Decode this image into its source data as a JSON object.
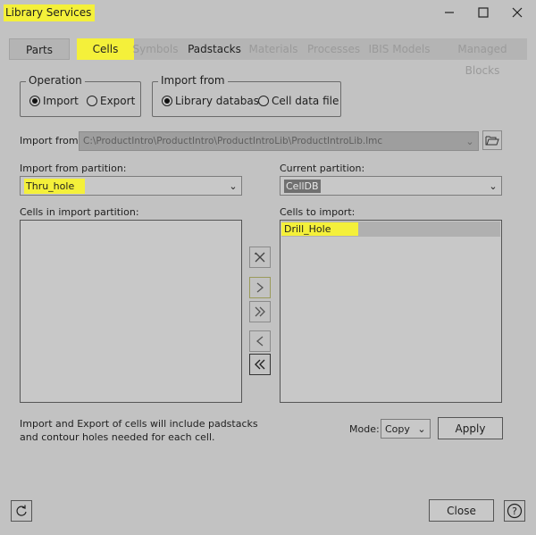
{
  "window": {
    "title": "Library Services"
  },
  "tabs": [
    {
      "label": "Parts",
      "state": "normal"
    },
    {
      "label": "Cells",
      "state": "active"
    },
    {
      "label": "Symbols",
      "state": "disabled"
    },
    {
      "label": "Padstacks",
      "state": "normal"
    },
    {
      "label": "Materials",
      "state": "disabled"
    },
    {
      "label": "Processes",
      "state": "disabled"
    },
    {
      "label": "IBIS Models",
      "state": "disabled"
    },
    {
      "label": "Managed Blocks",
      "state": "disabled"
    }
  ],
  "operation": {
    "legend": "Operation",
    "options": [
      "Import",
      "Export"
    ],
    "selected": "Import"
  },
  "import_from": {
    "legend": "Import from",
    "options": [
      "Library database",
      "Cell data file"
    ],
    "selected": "Library database"
  },
  "import_path": {
    "label": "Import from:",
    "value": "C:\\ProductIntro\\ProductIntro\\ProductIntroLib\\ProductIntroLib.lmc"
  },
  "import_partition": {
    "label": "Import from partition:",
    "value": "Thru_hole"
  },
  "current_partition": {
    "label": "Current partition:",
    "value": "CellDB"
  },
  "cells_in_partition": {
    "label": "Cells in import partition:",
    "items": []
  },
  "cells_to_import": {
    "label": "Cells to import:",
    "items": [
      "Drill_Hole"
    ]
  },
  "transfer_buttons": {
    "remove_all": "remove-all",
    "add": ">",
    "add_all": ">>",
    "remove": "<",
    "remove_back_all": "<<"
  },
  "note": {
    "line1": "Import and Export of cells will include padstacks",
    "line2": "and contour holes needed for each cell."
  },
  "mode": {
    "label": "Mode:",
    "value": "Copy"
  },
  "apply_label": "Apply",
  "close_label": "Close",
  "icons": {
    "refresh": "refresh-icon",
    "help": "help-icon",
    "browse": "folder-icon"
  },
  "highlight_color": "#f4f03a"
}
